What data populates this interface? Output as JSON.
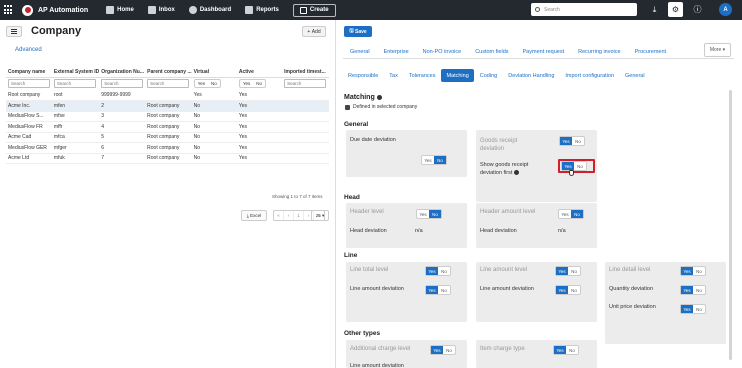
{
  "topbar": {
    "app_name": "AP Automation",
    "nav": [
      {
        "label": "Home",
        "icon": "home-icon"
      },
      {
        "label": "Inbox",
        "icon": "inbox-icon"
      },
      {
        "label": "Dashboard",
        "icon": "dashboard-icon"
      },
      {
        "label": "Reports",
        "icon": "reports-icon"
      }
    ],
    "create_label": "Create",
    "search_placeholder": "Search",
    "avatar_initial": "A"
  },
  "left": {
    "title": "Company",
    "add_label": "Add",
    "advanced_label": "Advanced",
    "columns": [
      "Company name",
      "External System ID",
      "Organization Nu...",
      "Parent company ...",
      "Virtual",
      "Active",
      "Imported timest..."
    ],
    "filter_placeholder": "Search",
    "filter_yes": "Yes",
    "filter_no": "No",
    "rows": [
      [
        "Root company",
        "root",
        "999999-9999",
        "",
        "Yes",
        "Yes",
        ""
      ],
      [
        "Acme Inc.",
        "mfen",
        "2",
        "Root company",
        "No",
        "Yes",
        ""
      ],
      [
        "MediusFlow S...",
        "mfse",
        "3",
        "Root company",
        "No",
        "Yes",
        ""
      ],
      [
        "MediusFlow FR",
        "mffr",
        "4",
        "Root company",
        "No",
        "Yes",
        ""
      ],
      [
        "Acme Cad",
        "mfca",
        "5",
        "Root company",
        "No",
        "Yes",
        ""
      ],
      [
        "MediusFlow GER",
        "mfger",
        "6",
        "Root company",
        "No",
        "Yes",
        ""
      ],
      [
        "Acme Ltd",
        "mfuk",
        "7",
        "Root company",
        "No",
        "Yes",
        ""
      ]
    ],
    "selected_row": 1,
    "showing": "Showing 1 to 7 of 7 items",
    "excel_label": "Excel",
    "page_number": "1",
    "page_size": "25"
  },
  "right": {
    "save_label": "Save",
    "tabs_top": [
      "General",
      "Enterprise",
      "Non-PO invoice",
      "Custom fields",
      "Payment request",
      "Recurring invoice",
      "Procurement"
    ],
    "more_label": "More",
    "tabs_sub": [
      "Responsible",
      "Tax",
      "Tolerances",
      "Matching",
      "Coding",
      "Deviation Handling",
      "Import configuration",
      "General"
    ],
    "active_sub_tab": "Matching",
    "matching_title": "Matching",
    "defined_label": "Defined in selected company",
    "sections": {
      "general": "General",
      "head": "Head",
      "line": "Line",
      "other": "Other types"
    },
    "yes": "Yes",
    "no": "No",
    "na": "n/a",
    "labels": {
      "due_date_deviation": "Due date deviation",
      "goods_receipt_deviation": "Goods receipt deviation",
      "show_goods_receipt_first": "Show goods receipt deviation first",
      "header_level": "Header level",
      "head_deviation": "Head deviation",
      "header_amount_level": "Header amount level",
      "line_total_level": "Line total level",
      "line_amount_deviation": "Line amount deviation",
      "line_amount_level": "Line amount level",
      "line_detail_level": "Line detail level",
      "quantity_deviation": "Quantity deviation",
      "unit_price_deviation": "Unit price deviation",
      "additional_charge_level": "Additional charge level",
      "item_charge_type": "Item charge type"
    }
  }
}
